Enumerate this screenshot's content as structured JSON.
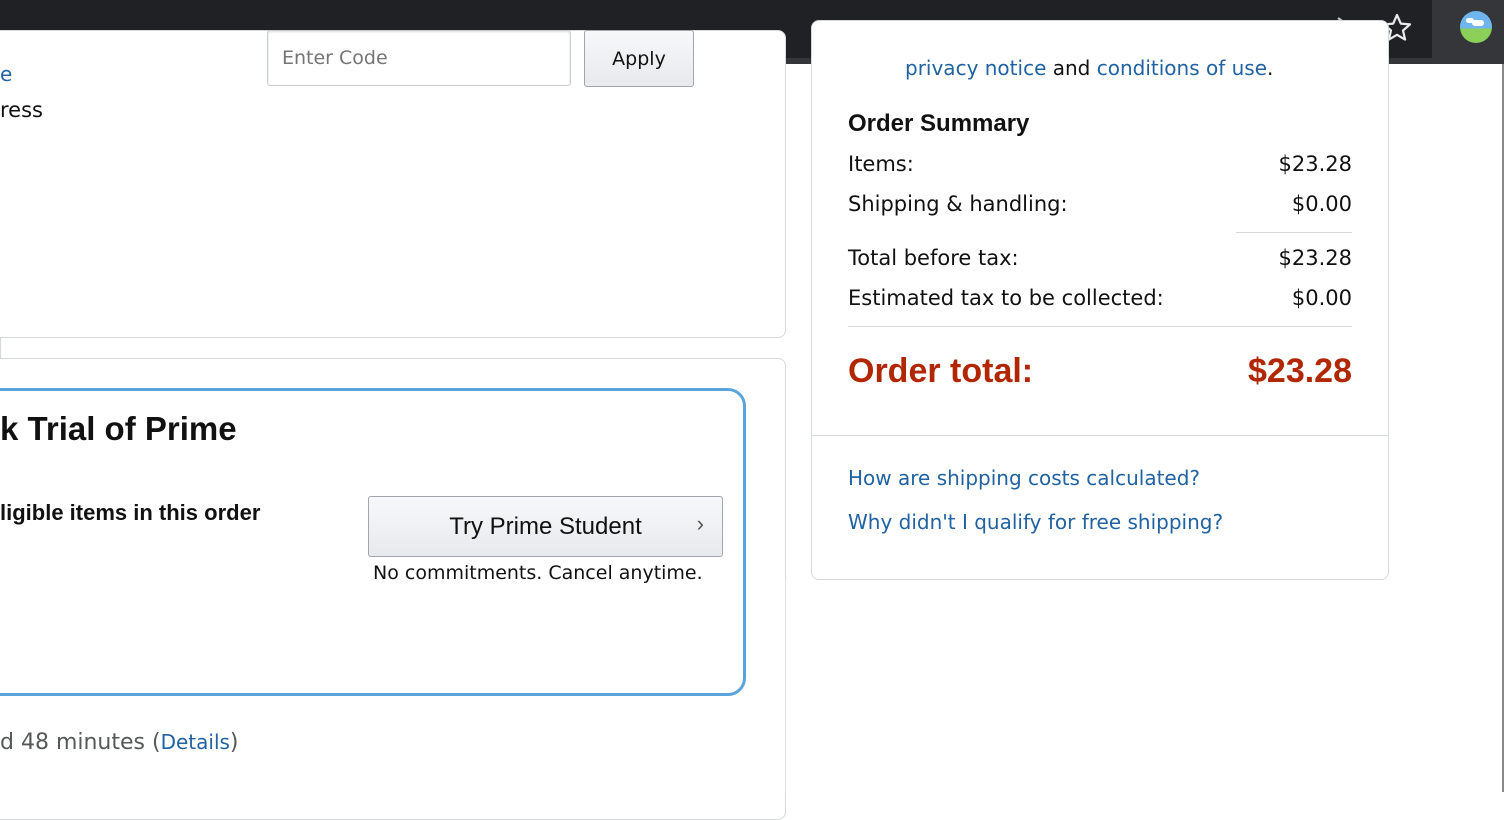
{
  "browser": {
    "icons": [
      "share-icon",
      "bookmark-star-icon",
      "profile-avatar"
    ]
  },
  "checkout": {
    "link_fragment": "e",
    "address_fragment": "ress",
    "promo": {
      "placeholder": "Enter Code",
      "apply_label": "Apply"
    },
    "prime_offer": {
      "title": "k Trial of Prime",
      "eligible_text": "ligible items in this order",
      "button_label": "Try Prime Student",
      "commitment_text": "No commitments. Cancel anytime."
    },
    "delivery": {
      "time_text": "d 48 minutes (",
      "details_link": "Details",
      "close_paren": ")"
    }
  },
  "summary": {
    "privacy_prefix": "privacy notice",
    "privacy_and": " and ",
    "conditions_link": "conditions of use",
    "privacy_suffix": ".",
    "heading": "Order Summary",
    "rows": [
      {
        "label": "Items:",
        "value": "$23.28"
      },
      {
        "label": "Shipping & handling:",
        "value": "$0.00"
      },
      {
        "label": "Total before tax:",
        "value": "$23.28"
      },
      {
        "label": "Estimated tax to be collected:",
        "value": "$0.00"
      }
    ],
    "total_label": "Order total:",
    "total_value": "$23.28",
    "help_links": [
      "How are shipping costs calculated?",
      "Why didn't I qualify for free shipping?"
    ]
  },
  "colors": {
    "link": "#2162a1",
    "order_total": "#b12704",
    "prime_border": "#5ba4d9",
    "topbar": "#202124"
  }
}
